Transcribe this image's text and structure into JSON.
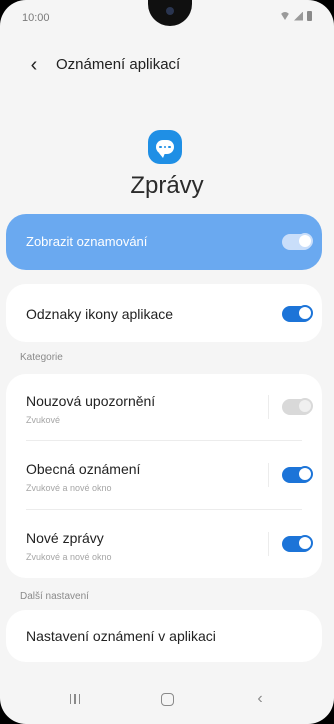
{
  "status_bar": {
    "time": "10:00",
    "icons": [
      "wifi-icon",
      "signal-icon",
      "battery-icon"
    ]
  },
  "header": {
    "back_icon": "chevron-left-icon",
    "title": "Oznámení aplikací"
  },
  "app": {
    "icon": "message-bubble-icon",
    "icon_color": "#1f8fe5",
    "name": "Zprávy"
  },
  "main_toggle": {
    "label": "Zobrazit oznamování",
    "on": true,
    "background": "#6aa9f0"
  },
  "badges": {
    "label": "Odznaky ikony aplikace",
    "on": true
  },
  "categories": {
    "section_label": "Kategorie",
    "items": [
      {
        "title": "Nouzová upozornění",
        "subtitle": "Zvukové",
        "state": "disabled-on"
      },
      {
        "title": "Obecná oznámení",
        "subtitle": "Zvukové a nové okno",
        "state": "on"
      },
      {
        "title": "Nové zprávy",
        "subtitle": "Zvukové a nové okno",
        "state": "on"
      }
    ]
  },
  "more_settings": {
    "section_label": "Další nastavení",
    "item_label": "Nastavení oznámení v aplikaci"
  },
  "nav_bar": {
    "recents_icon": "recents-icon",
    "home_icon": "home-icon",
    "back_icon": "back-icon"
  },
  "colors": {
    "accent": "#1c74d8",
    "background": "#f5f5f5"
  }
}
